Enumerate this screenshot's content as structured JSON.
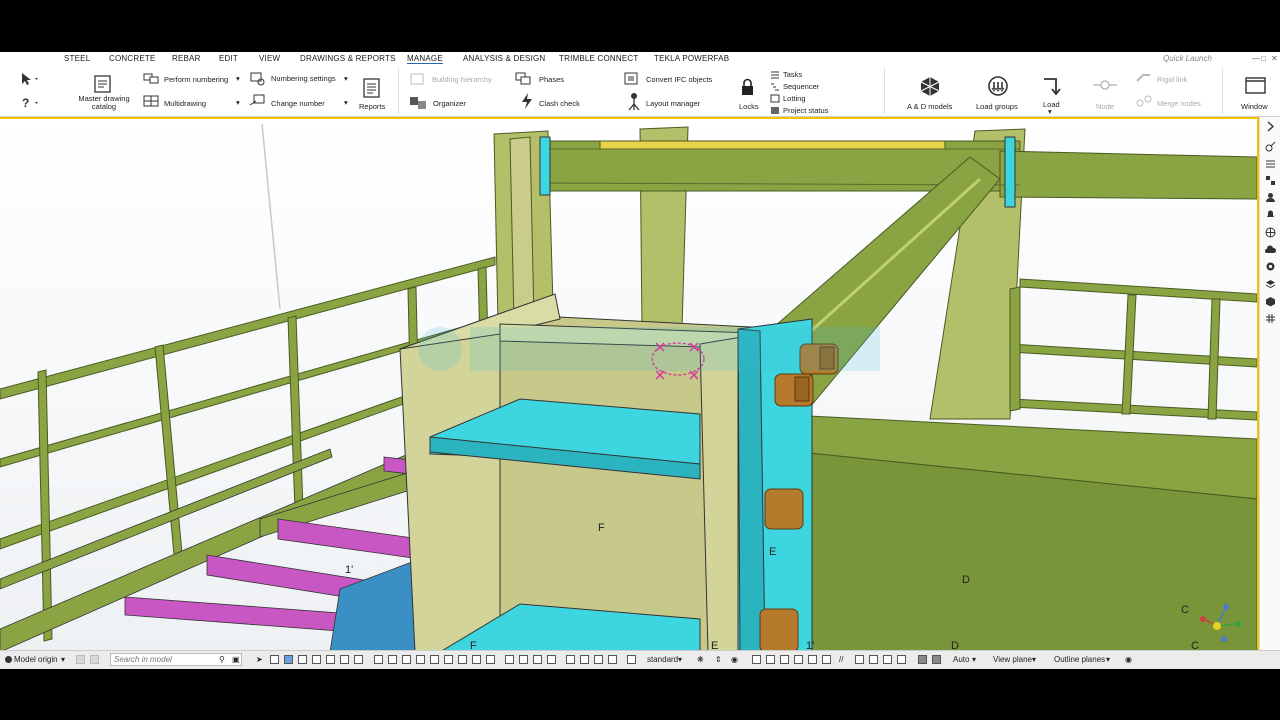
{
  "menu_tabs": [
    "STEEL",
    "CONCRETE",
    "REBAR",
    "EDIT",
    "VIEW",
    "DRAWINGS & REPORTS",
    "MANAGE",
    "ANALYSIS & DESIGN",
    "TRIMBLE CONNECT",
    "TEKLA POWERFAB"
  ],
  "active_tab": "MANAGE",
  "quick_launch_placeholder": "Quick Launch",
  "ribbon": {
    "master_drawing_catalog": "Master drawing catalog",
    "perform_numbering": "Perform numbering",
    "multidrawing": "Multidrawing",
    "numbering_settings": "Numbering settings",
    "change_number": "Change number",
    "reports": "Reports",
    "building_hierarchy": "Building hierarchy",
    "organizer": "Organizer",
    "phases": "Phases",
    "clash_check": "Clash check",
    "convert_ifc_objects": "Convert IFC objects",
    "layout_manager": "Layout manager",
    "locks": "Locks",
    "tasks": "Tasks",
    "sequencer": "Sequencer",
    "lotting": "Lotting",
    "project_status": "Project status",
    "ad_models": "A & D models",
    "load_groups": "Load groups",
    "load": "Load",
    "node": "Node",
    "rigid_link": "Rigid link",
    "merge_nodes": "Merge nodes",
    "window": "Window"
  },
  "viewport_labels": {
    "F_center": "F",
    "F_bottom": "F",
    "E_mid": "E",
    "E_bottom": "E",
    "D_right": "D",
    "D_bottom": "D",
    "C_right": "C",
    "C_bottom": "C",
    "one_prime_left": "1'",
    "one_prime_bottom": "1'"
  },
  "statusbar": {
    "model_origin": "Model origin",
    "search_placeholder": "Search in model",
    "standard": "standard",
    "auto": "Auto",
    "view_plane": "View plane",
    "outline_planes": "Outline planes"
  },
  "colors": {
    "steel_green": "#8aa444",
    "plate_beige": "#d2d49a",
    "stiffener_cyan": "#3dd6e0",
    "joist_magenta": "#c857c4",
    "bolt_brown": "#b57a2c",
    "selection_yellow": "#f2c200"
  }
}
